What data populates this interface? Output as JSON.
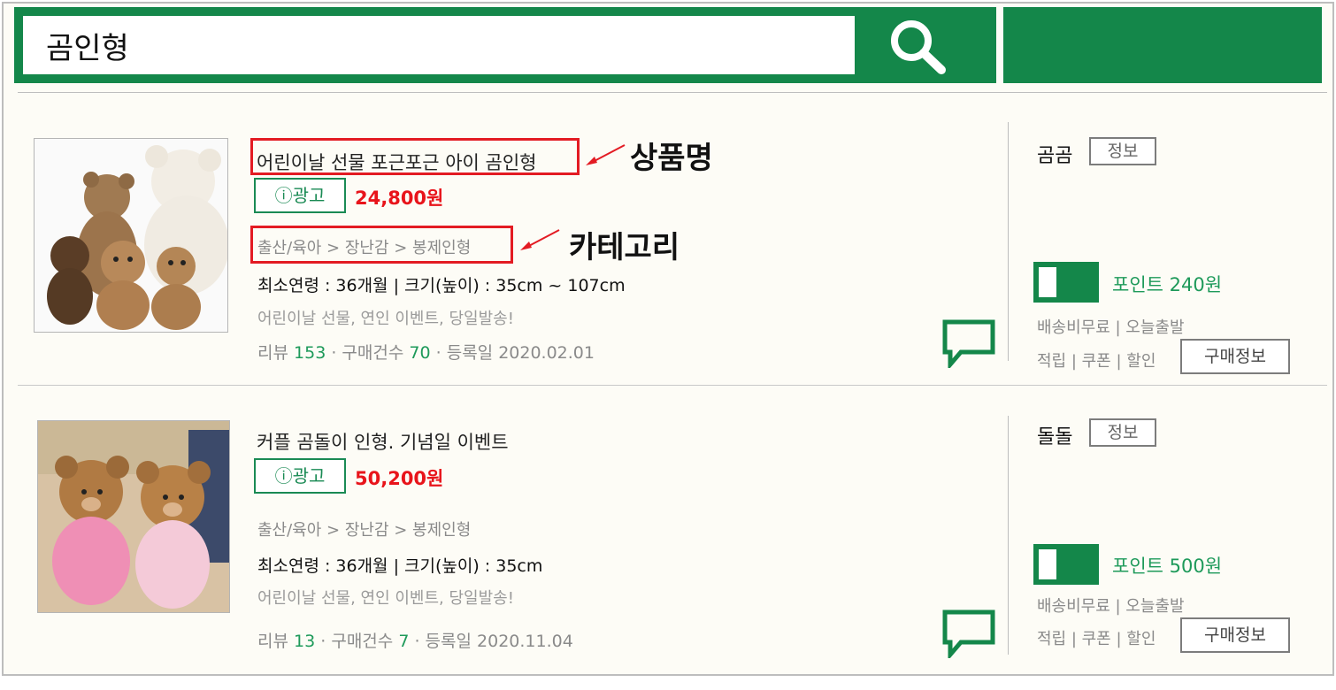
{
  "search": {
    "query": "곰인형"
  },
  "products": [
    {
      "name": "어린이날 선물 포근포근 아이 곰인형",
      "ad_label": "ⓘ광고",
      "price": "24,800원",
      "category": "출산/육아 > 장난감 > 봉제인형",
      "spec": "최소연령 : 36개월 | 크기(높이) : 35cm ~ 107cm",
      "desc": "어린이날 선물, 연인 이벤트, 당일발송!",
      "review_label": "리뷰",
      "review_count": "153",
      "purchase_label": "구매건수",
      "purchase_count": "70",
      "reg_label": "등록일 2020.02.01",
      "seller": "곰곰",
      "info_label": "정보",
      "point": "포인트 240원",
      "shipping": "배송비무료 | 오늘출발",
      "benefits": "적립 | 쿠폰 | 할인",
      "buy_label": "구매정보"
    },
    {
      "name": "커플 곰돌이 인형. 기념일 이벤트",
      "ad_label": "ⓘ광고",
      "price": "50,200원",
      "category": "출산/육아 > 장난감 > 봉제인형",
      "spec": "최소연령 : 36개월 | 크기(높이) : 35cm",
      "desc": "어린이날 선물, 연인 이벤트, 당일발송!",
      "review_label": "리뷰",
      "review_count": "13",
      "purchase_label": "구매건수",
      "purchase_count": "7",
      "reg_label": "등록일 2020.11.04",
      "seller": "돌돌",
      "info_label": "정보",
      "point": "포인트 500원",
      "shipping": "배송비무료 | 오늘출발",
      "benefits": "적립 | 쿠폰 | 할인",
      "buy_label": "구매정보"
    }
  ],
  "annotations": {
    "product_name": "상품명",
    "category": "카테고리"
  },
  "colors": {
    "brand_green": "#14874a",
    "price_red": "#e8141b",
    "annotation_red": "#e31b23"
  }
}
